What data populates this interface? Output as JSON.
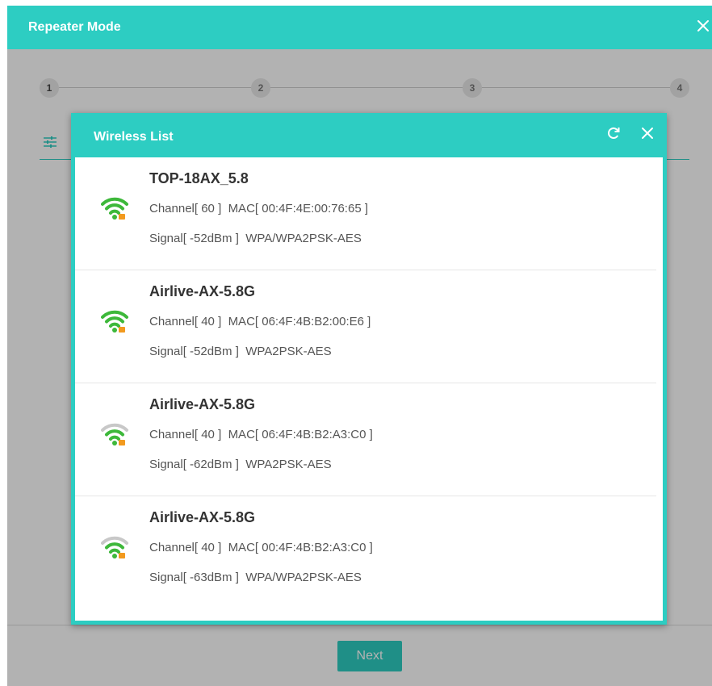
{
  "outer_dialog": {
    "title": "Repeater Mode",
    "close_icon": "close-icon",
    "steps": [
      "1",
      "2",
      "3",
      "4"
    ],
    "next_label": "Next"
  },
  "modal": {
    "title": "Wireless List",
    "refresh_icon": "refresh-icon",
    "close_icon": "close-icon"
  },
  "networks": [
    {
      "ssid": "TOP-18AX_5.8",
      "line1": "Channel[ 60 ]  MAC[ 00:4F:4E:00:76:65 ]",
      "line2": "Signal[ -52dBm ]  WPA/WPA2PSK-AES",
      "signal_bars": 3
    },
    {
      "ssid": "Airlive-AX-5.8G",
      "line1": "Channel[ 40 ]  MAC[ 06:4F:4B:B2:00:E6 ]",
      "line2": "Signal[ -52dBm ]  WPA2PSK-AES",
      "signal_bars": 3
    },
    {
      "ssid": "Airlive-AX-5.8G",
      "line1": "Channel[ 40 ]  MAC[ 06:4F:4B:B2:A3:C0 ]",
      "line2": "Signal[ -62dBm ]  WPA2PSK-AES",
      "signal_bars": 2
    },
    {
      "ssid": "Airlive-AX-5.8G",
      "line1": "Channel[ 40 ]  MAC[ 00:4F:4B:B2:A3:C0 ]",
      "line2": "Signal[ -63dBm ]  WPA/WPA2PSK-AES",
      "signal_bars": 2
    }
  ],
  "colors": {
    "accent": "#2dcdc2",
    "signal_on": "#3db83a",
    "signal_off": "#c8c8c8",
    "lock": "#f29a1f"
  }
}
